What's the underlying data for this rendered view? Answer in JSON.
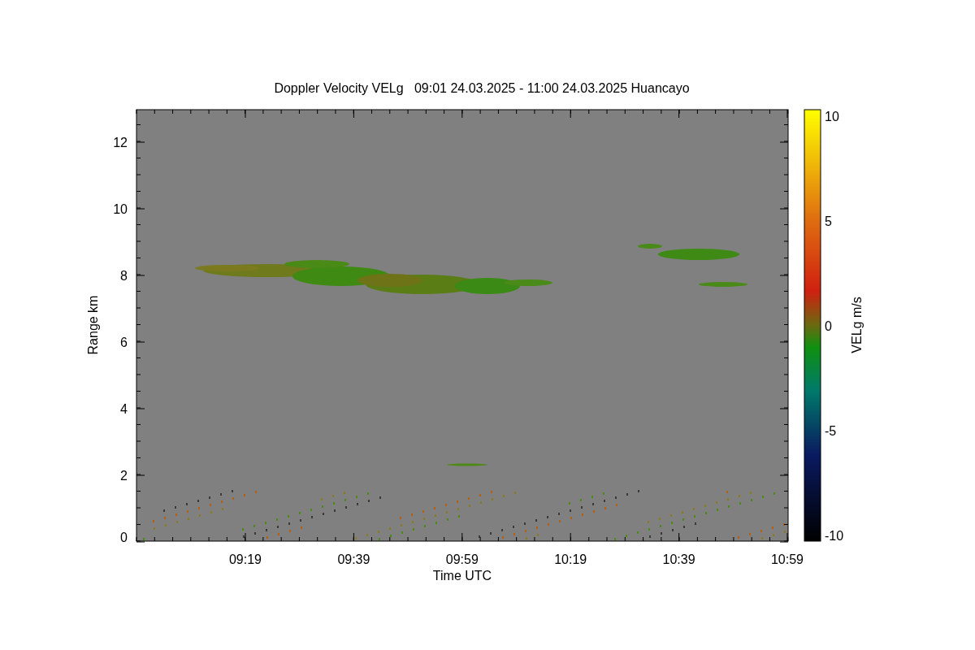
{
  "title": "Doppler Velocity VELg   09:01 24.03.2025 - 11:00 24.03.2025 Huancayo",
  "x_axis": {
    "label": "Time UTC",
    "ticks": [
      "09:19",
      "09:39",
      "09:59",
      "10:19",
      "10:39",
      "10:59"
    ]
  },
  "y_axis": {
    "label": "Range km",
    "ticks": [
      "12",
      "10",
      "8",
      "6",
      "4",
      "2",
      "0"
    ]
  },
  "colorbar": {
    "label": "VELg m/s",
    "ticks": [
      "10",
      "5",
      "0",
      "-5",
      "-10"
    ]
  }
}
